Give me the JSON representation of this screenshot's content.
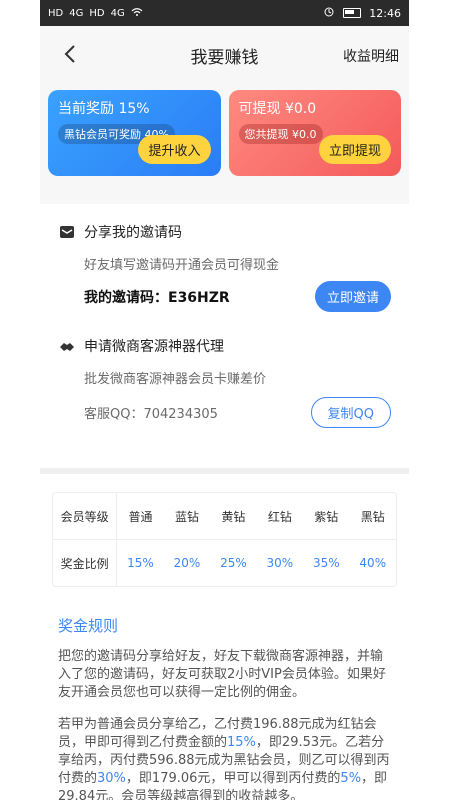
{
  "status_bar": {
    "left_text_1": "HD",
    "left_text_2": "4G",
    "left_text_3": "HD",
    "left_text_4": "4G",
    "time": "12:46"
  },
  "header": {
    "title": "我要赚钱",
    "right_link": "收益明细"
  },
  "cards": {
    "left": {
      "title": "当前奖励 15%",
      "pill": "黑钻会员可奖励 40%",
      "button": "提升收入"
    },
    "right": {
      "title": "可提现 ¥0.0",
      "pill": "您共提现 ¥0.0",
      "button": "立即提现"
    }
  },
  "share": {
    "title": "分享我的邀请码",
    "desc": "好友填写邀请码开通会员可得现金",
    "code_label": "我的邀请码：E36HZR",
    "button": "立即邀请"
  },
  "agent": {
    "title": "申请微商客源神器代理",
    "desc": "批发微商客源神器会员卡赚差价",
    "qq": "客服QQ：704234305",
    "button": "复制QQ"
  },
  "table": {
    "headers": [
      "会员等级",
      "普通",
      "蓝钻",
      "黄钻",
      "红钻",
      "紫钻",
      "黑钻"
    ],
    "row": [
      "奖金比例",
      "15%",
      "20%",
      "25%",
      "30%",
      "35%",
      "40%"
    ]
  },
  "rules": {
    "title": "奖金规则",
    "p1": "把您的邀请码分享给好友，好友下载微商客源神器，并输入了您的邀请码，好友可获取2小时VIP会员体验。如果好友开通会员您也可以获得一定比例的佣金。",
    "p2a": "若甲为普通会员分享给乙，乙付费196.88元成为红钻会员，甲即可得到乙付费金额的",
    "p2b": "15%",
    "p2c": "，即29.53元。乙若分享给丙，丙付费596.88元成为黑钻会员，则乙可以得到丙付费的",
    "p2d": "30%",
    "p2e": "，即179.06元，甲可以得到丙付费的",
    "p2f": "5%",
    "p2g": "，即29.84元。会员等级越高得到的收益越多。"
  }
}
